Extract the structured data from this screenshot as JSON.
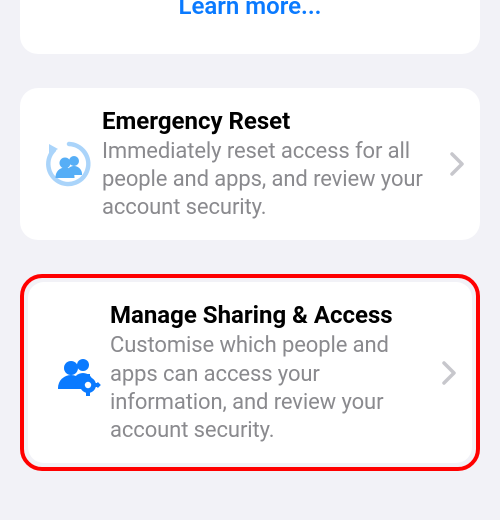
{
  "top_card": {
    "learn_more_label": "Learn more..."
  },
  "emergency": {
    "title": "Emergency Reset",
    "subtitle": "Immediately reset access for all people and apps, and review your account security."
  },
  "manage": {
    "title": "Manage Sharing & Access",
    "subtitle": "Customise which people and apps can access your information, and review your account security."
  },
  "colors": {
    "accent_light_blue": "#56aef6",
    "accent_blue": "#0a7aff",
    "gray_text": "#8a8a8e",
    "chevron": "#c7c7cc",
    "highlight": "#ff0000"
  }
}
